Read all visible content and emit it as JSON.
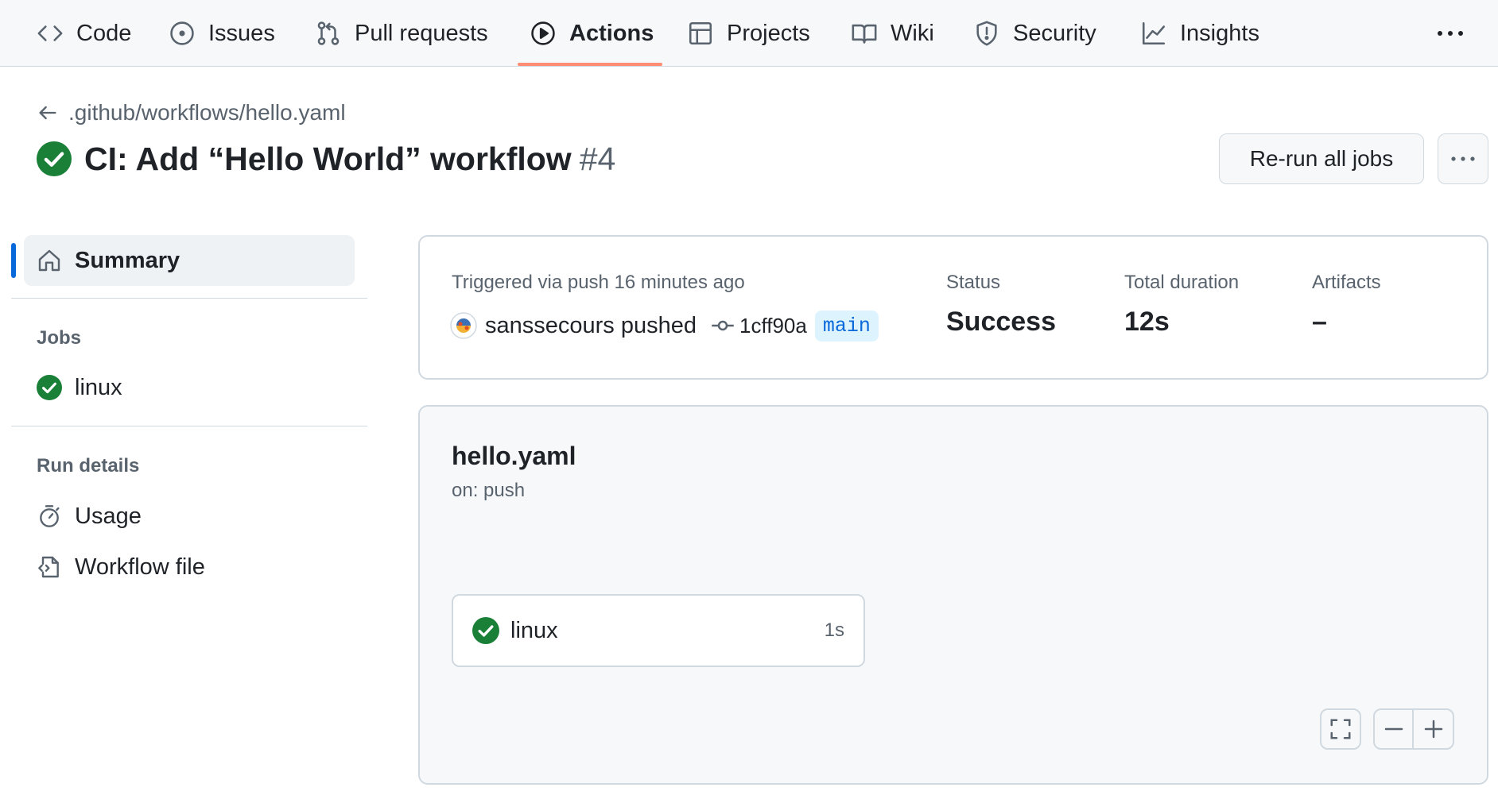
{
  "tabs": [
    {
      "label": "Code",
      "icon": "code-icon"
    },
    {
      "label": "Issues",
      "icon": "issue-icon"
    },
    {
      "label": "Pull requests",
      "icon": "pull-request-icon"
    },
    {
      "label": "Actions",
      "icon": "play-icon",
      "selected": true
    },
    {
      "label": "Projects",
      "icon": "table-icon"
    },
    {
      "label": "Wiki",
      "icon": "book-icon"
    },
    {
      "label": "Security",
      "icon": "shield-icon"
    },
    {
      "label": "Insights",
      "icon": "graph-icon"
    }
  ],
  "header": {
    "back_path": ".github/workflows/hello.yaml",
    "title": "CI: Add “Hello World” workflow",
    "run_number": "#4",
    "rerun_label": "Re-run all jobs"
  },
  "sidebar": {
    "summary_label": "Summary",
    "jobs_heading": "Jobs",
    "jobs": [
      {
        "label": "linux",
        "status": "success"
      }
    ],
    "run_details_heading": "Run details",
    "details": [
      {
        "label": "Usage",
        "icon": "stopwatch-icon"
      },
      {
        "label": "Workflow file",
        "icon": "file-code-icon"
      }
    ]
  },
  "summary": {
    "triggered": "Triggered via push 16 minutes ago",
    "actor": "sanssecours pushed",
    "sha": "1cff90a",
    "branch": "main",
    "status_label": "Status",
    "status_value": "Success",
    "duration_label": "Total duration",
    "duration_value": "12s",
    "artifacts_label": "Artifacts",
    "artifacts_value": "–"
  },
  "graph": {
    "workflow_name": "hello.yaml",
    "trigger": "on: push",
    "job": {
      "name": "linux",
      "duration": "1s"
    }
  },
  "colors": {
    "success": "#1a7f37",
    "accent": "#0969da",
    "tab_underline": "#fd8c73"
  }
}
